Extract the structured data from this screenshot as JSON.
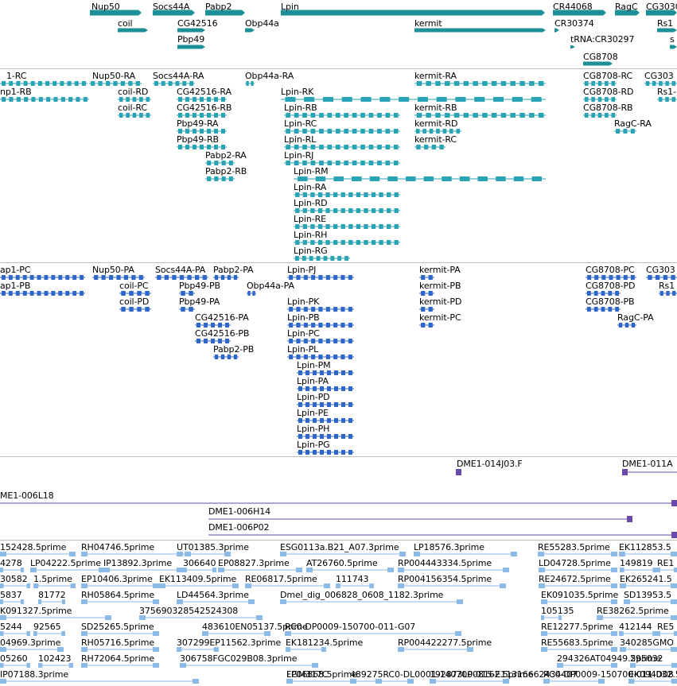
{
  "colors": {
    "gene": "#1d8f99",
    "transcript": "#2aa3b4",
    "cds": "#2f67c9",
    "clone": "#6a4aa8",
    "est": "#8bbbe6",
    "separator": "#c0c0c0"
  },
  "tracks": [
    {
      "name": "genes",
      "features": [
        {
          "label": "Nup50"
        },
        {
          "label": "Socs44A"
        },
        {
          "label": "Pabp2"
        },
        {
          "label": "Lpin"
        },
        {
          "label": "CR44068"
        },
        {
          "label": "RagC"
        },
        {
          "label": "CG3030"
        },
        {
          "label": "coil"
        },
        {
          "label": "CG42516"
        },
        {
          "label": "Obp44a"
        },
        {
          "label": "kermit"
        },
        {
          "label": "CR30374"
        },
        {
          "label": "Rs1"
        },
        {
          "label": "Pbp49"
        },
        {
          "label": "tRNA:CR30297"
        },
        {
          "label": "s"
        },
        {
          "label": "CG8708"
        }
      ]
    },
    {
      "name": "transcripts",
      "features": [
        {
          "label": "1-RC"
        },
        {
          "label": "Nup50-RA"
        },
        {
          "label": "Socs44A-RA"
        },
        {
          "label": "Obp44a-RA"
        },
        {
          "label": "kermit-RA"
        },
        {
          "label": "CG8708-RC"
        },
        {
          "label": "CG303"
        },
        {
          "label": "np1-RB"
        },
        {
          "label": "coil-RD"
        },
        {
          "label": "CG42516-RA"
        },
        {
          "label": "Lpin-RK"
        },
        {
          "label": "CG8708-RD"
        },
        {
          "label": "Rs1-"
        },
        {
          "label": "coil-RC"
        },
        {
          "label": "CG42516-RB"
        },
        {
          "label": "Lpin-RB"
        },
        {
          "label": "kermit-RB"
        },
        {
          "label": "CG8708-RB"
        },
        {
          "label": "Pbp49-RA"
        },
        {
          "label": "Lpin-RC"
        },
        {
          "label": "kermit-RD"
        },
        {
          "label": "RagC-RA"
        },
        {
          "label": "Pbp49-RB"
        },
        {
          "label": "Lpin-RL"
        },
        {
          "label": "kermit-RC"
        },
        {
          "label": "Pabp2-RA"
        },
        {
          "label": "Lpin-RJ"
        },
        {
          "label": "Pabp2-RB"
        },
        {
          "label": "Lpin-RM"
        },
        {
          "label": "Lpin-RA"
        },
        {
          "label": "Lpin-RD"
        },
        {
          "label": "Lpin-RE"
        },
        {
          "label": "Lpin-RH"
        },
        {
          "label": "Lpin-RG"
        }
      ]
    },
    {
      "name": "proteins",
      "features": [
        {
          "label": "ap1-PC"
        },
        {
          "label": "Nup50-PA"
        },
        {
          "label": "Socs44A-PA"
        },
        {
          "label": "Pabp2-PA"
        },
        {
          "label": "Lpin-PJ"
        },
        {
          "label": "kermit-PA"
        },
        {
          "label": "CG8708-PC"
        },
        {
          "label": "CG303"
        },
        {
          "label": "ap1-PB"
        },
        {
          "label": "coil-PC"
        },
        {
          "label": "Pbp49-PB"
        },
        {
          "label": "Obp44a-PA"
        },
        {
          "label": "kermit-PB"
        },
        {
          "label": "CG8708-PD"
        },
        {
          "label": "Rs1"
        },
        {
          "label": "coil-PD"
        },
        {
          "label": "Pbp49-PA"
        },
        {
          "label": "Lpin-PK"
        },
        {
          "label": "kermit-PD"
        },
        {
          "label": "CG8708-PB"
        },
        {
          "label": "CG42516-PA"
        },
        {
          "label": "Lpin-PB"
        },
        {
          "label": "kermit-PC"
        },
        {
          "label": "RagC-PA"
        },
        {
          "label": "CG42516-PB"
        },
        {
          "label": "Lpin-PC"
        },
        {
          "label": "Pabp2-PB"
        },
        {
          "label": "Lpin-PL"
        },
        {
          "label": "Lpin-PM"
        },
        {
          "label": "Lpin-PA"
        },
        {
          "label": "Lpin-PD"
        },
        {
          "label": "Lpin-PE"
        },
        {
          "label": "Lpin-PH"
        },
        {
          "label": "Lpin-PG"
        }
      ]
    },
    {
      "name": "clones",
      "features": [
        {
          "label": "DME1-014J03.F"
        },
        {
          "label": "DME1-011A"
        },
        {
          "label": "ME1-006L18"
        },
        {
          "label": "DME1-006H14"
        },
        {
          "label": "DME1-006P02"
        }
      ]
    },
    {
      "name": "ests",
      "features": [
        {
          "label": "152428.5prime"
        },
        {
          "label": "RH04746.5prime"
        },
        {
          "label": "UT01385.3prime"
        },
        {
          "label": "ESG0113a.B21_A07.3prime"
        },
        {
          "label": "LP18576.3prime"
        },
        {
          "label": "RE55283.5prime"
        },
        {
          "label": "EK112853.5"
        },
        {
          "label": "4278"
        },
        {
          "label": "LP04222.5prime"
        },
        {
          "label": "IP13892.3prime"
        },
        {
          "label": "306640"
        },
        {
          "label": "EP08827.3prime"
        },
        {
          "label": "AT26760.5prime"
        },
        {
          "label": "RP004443334.5prime"
        },
        {
          "label": "LD04728.5prime"
        },
        {
          "label": "149819"
        },
        {
          "label": "RE1"
        },
        {
          "label": "30582"
        },
        {
          "label": "1.5prime"
        },
        {
          "label": "EP10406.3prime"
        },
        {
          "label": "EK113409.5prime"
        },
        {
          "label": "RE06817.5prime"
        },
        {
          "label": "111743"
        },
        {
          "label": "RP004156354.5prime"
        },
        {
          "label": "RE24672.5prime"
        },
        {
          "label": "EK265241.5"
        },
        {
          "label": "5837"
        },
        {
          "label": "81772"
        },
        {
          "label": "RH05864.5prime"
        },
        {
          "label": "LD44564.3prime"
        },
        {
          "label": "Dmel_dig_006828_0608_1182.3prime"
        },
        {
          "label": "EK091035.5prime"
        },
        {
          "label": "SD13953.5"
        },
        {
          "label": "K091327.5prime"
        },
        {
          "label": "375690328542524308"
        },
        {
          "label": "105135"
        },
        {
          "label": "RE38262.5prime"
        },
        {
          "label": "5244"
        },
        {
          "label": "92565"
        },
        {
          "label": "SD25265.5prime"
        },
        {
          "label": "483610EN05137.5prime"
        },
        {
          "label": "RC0-DP0009-150700-011-G07"
        },
        {
          "label": "RE12277.5prime"
        },
        {
          "label": "412144"
        },
        {
          "label": "RE5"
        },
        {
          "label": "04969.3prime"
        },
        {
          "label": "RH05716.5prime"
        },
        {
          "label": "307299EP11562.3prime"
        },
        {
          "label": "EK181234.5prime"
        },
        {
          "label": "RP004422277.5prime"
        },
        {
          "label": "RE55683.5prime"
        },
        {
          "label": "340285GMO"
        },
        {
          "label": "05260"
        },
        {
          "label": "102423"
        },
        {
          "label": "RH72064.5prime"
        },
        {
          "label": "306758FGC029B08.3prime"
        },
        {
          "label": "294326AT04949.5prime"
        },
        {
          "label": "295032"
        },
        {
          "label": "IP07188.3prime"
        },
        {
          "label": "FGM317C"
        },
        {
          "label": "489275RC0-DL0001-140700-015-E11316662434407"
        },
        {
          "label": "192873LP08162.5prime"
        },
        {
          "label": "LP06868.5prime"
        },
        {
          "label": "RC0-DP0009-150700-011-D08"
        },
        {
          "label": "EK094032.5prime"
        },
        {
          "label": "UT01362.5"
        }
      ]
    }
  ]
}
